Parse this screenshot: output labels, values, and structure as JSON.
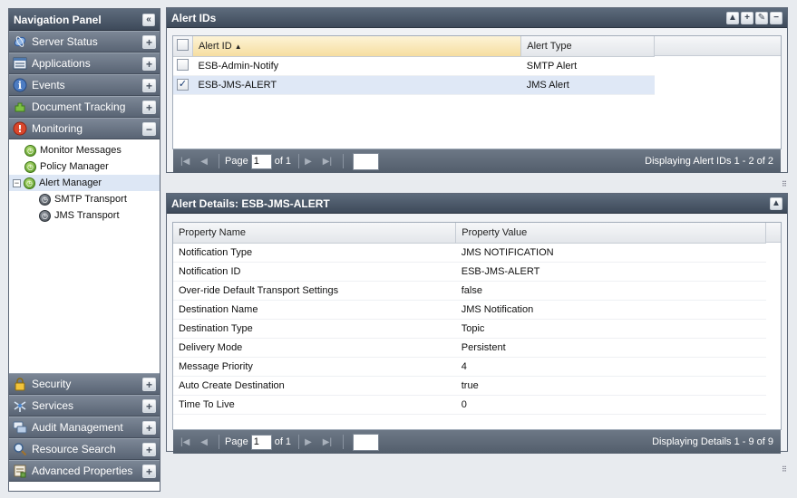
{
  "nav": {
    "title": "Navigation Panel",
    "sections_top": [
      {
        "label": "Server Status",
        "icon": "server-status-icon"
      },
      {
        "label": "Applications",
        "icon": "applications-icon"
      },
      {
        "label": "Events",
        "icon": "events-icon"
      },
      {
        "label": "Document Tracking",
        "icon": "document-tracking-icon"
      },
      {
        "label": "Monitoring",
        "icon": "monitoring-icon"
      }
    ],
    "tree": [
      {
        "label": "Monitor Messages"
      },
      {
        "label": "Policy Manager"
      },
      {
        "label": "Alert Manager"
      },
      {
        "label": "SMTP Transport"
      },
      {
        "label": "JMS Transport"
      }
    ],
    "sections_bottom": [
      {
        "label": "Security",
        "icon": "security-lock-icon"
      },
      {
        "label": "Services",
        "icon": "services-icon"
      },
      {
        "label": "Audit Management",
        "icon": "audit-management-icon"
      },
      {
        "label": "Resource Search",
        "icon": "resource-search-icon"
      },
      {
        "label": "Advanced Properties",
        "icon": "advanced-properties-icon"
      }
    ]
  },
  "alert_ids": {
    "title": "Alert IDs",
    "columns": [
      "Alert ID",
      "Alert Type"
    ],
    "rows": [
      {
        "id": "ESB-Admin-Notify",
        "type": "SMTP Alert",
        "checked": false
      },
      {
        "id": "ESB-JMS-ALERT",
        "type": "JMS Alert",
        "checked": true
      }
    ],
    "pager": {
      "page_label": "Page",
      "page": "1",
      "of_label": "of 1",
      "status": "Displaying Alert IDs 1 - 2 of 2"
    }
  },
  "alert_details": {
    "title": "Alert Details: ESB-JMS-ALERT",
    "columns": [
      "Property Name",
      "Property Value"
    ],
    "rows": [
      {
        "name": "Notification Type",
        "value": "JMS NOTIFICATION"
      },
      {
        "name": "Notification ID",
        "value": "ESB-JMS-ALERT"
      },
      {
        "name": "Over-ride Default Transport Settings",
        "value": "false"
      },
      {
        "name": "Destination Name",
        "value": "JMS Notification"
      },
      {
        "name": "Destination Type",
        "value": "Topic"
      },
      {
        "name": "Delivery Mode",
        "value": "Persistent"
      },
      {
        "name": "Message Priority",
        "value": "4"
      },
      {
        "name": "Auto Create Destination",
        "value": "true"
      },
      {
        "name": "Time To Live",
        "value": "0"
      }
    ],
    "pager": {
      "page_label": "Page",
      "page": "1",
      "of_label": "of 1",
      "status": "Displaying Details 1 - 9 of 9"
    }
  }
}
